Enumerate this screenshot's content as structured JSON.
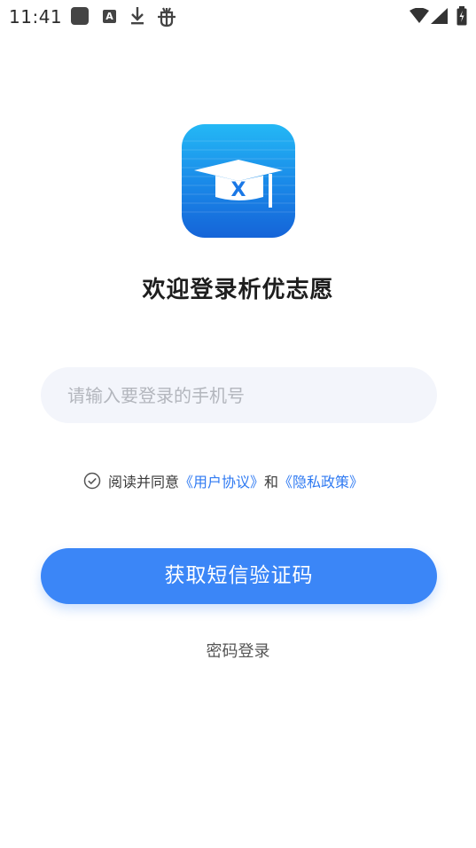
{
  "status_bar": {
    "time": "11:41",
    "notification_icons": [
      "square-app-icon",
      "a-box-icon",
      "download-icon",
      "bug-icon"
    ],
    "system_icons": [
      "wifi-icon",
      "signal-icon",
      "battery-icon"
    ]
  },
  "logo": {
    "icon": "graduation-cap-logo",
    "text": "X"
  },
  "title": "欢迎登录析优志愿",
  "phone_input": {
    "value": "",
    "placeholder": "请输入要登录的手机号"
  },
  "agreement": {
    "prefix": "阅读并同意",
    "user_agreement": "《用户协议》",
    "conjunction": "和",
    "privacy_policy": "《隐私政策》",
    "link_color": "#2f7af2"
  },
  "primary_button": {
    "label": "获取短信验证码",
    "color": "#3b86f7"
  },
  "secondary_link": "密码登录"
}
